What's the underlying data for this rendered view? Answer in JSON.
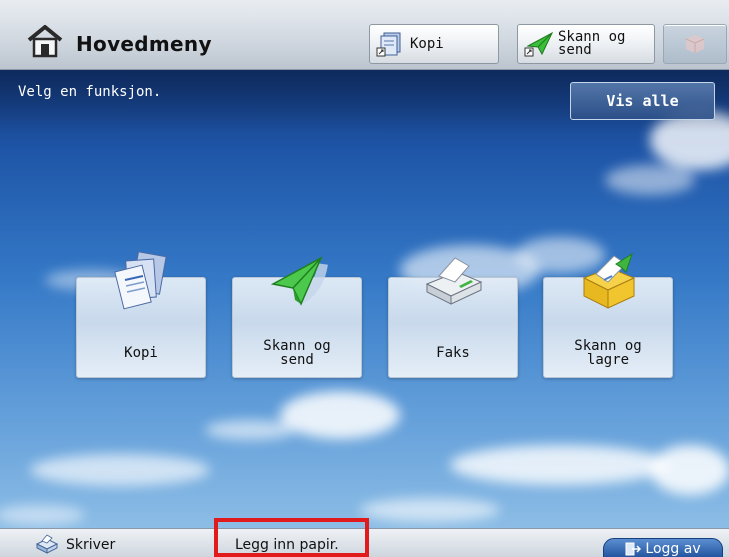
{
  "header": {
    "title": "Hovedmeny",
    "kopi_label": "Kopi",
    "skann_send_label": "Skann og\nsend"
  },
  "main": {
    "instruction": "Velg en funksjon.",
    "vis_alle_label": "Vis alle",
    "tiles": [
      {
        "label": "Kopi",
        "icon": "copy-icon"
      },
      {
        "label": "Skann og\nsend",
        "icon": "paper-plane-send-icon"
      },
      {
        "label": "Faks",
        "icon": "fax-icon"
      },
      {
        "label": "Skann og\nlagre",
        "icon": "store-folder-icon"
      }
    ]
  },
  "status": {
    "printer_label": "Skriver",
    "message": "Legg inn papir.",
    "logout_label": "Logg av"
  },
  "colors": {
    "highlight_border": "#e11b1b",
    "logout_button": "#2a5fad"
  }
}
